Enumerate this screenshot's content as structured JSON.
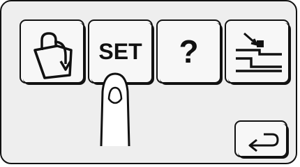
{
  "buttons": {
    "set_label": "SET",
    "help_label": "?"
  },
  "icons": {
    "save": "shopping-bag-arrow-icon",
    "set": "set-text",
    "help": "question-mark",
    "edit": "stitch-step-icon",
    "return": "return-arrow-icon",
    "pointer": "finger-pointer-icon"
  }
}
